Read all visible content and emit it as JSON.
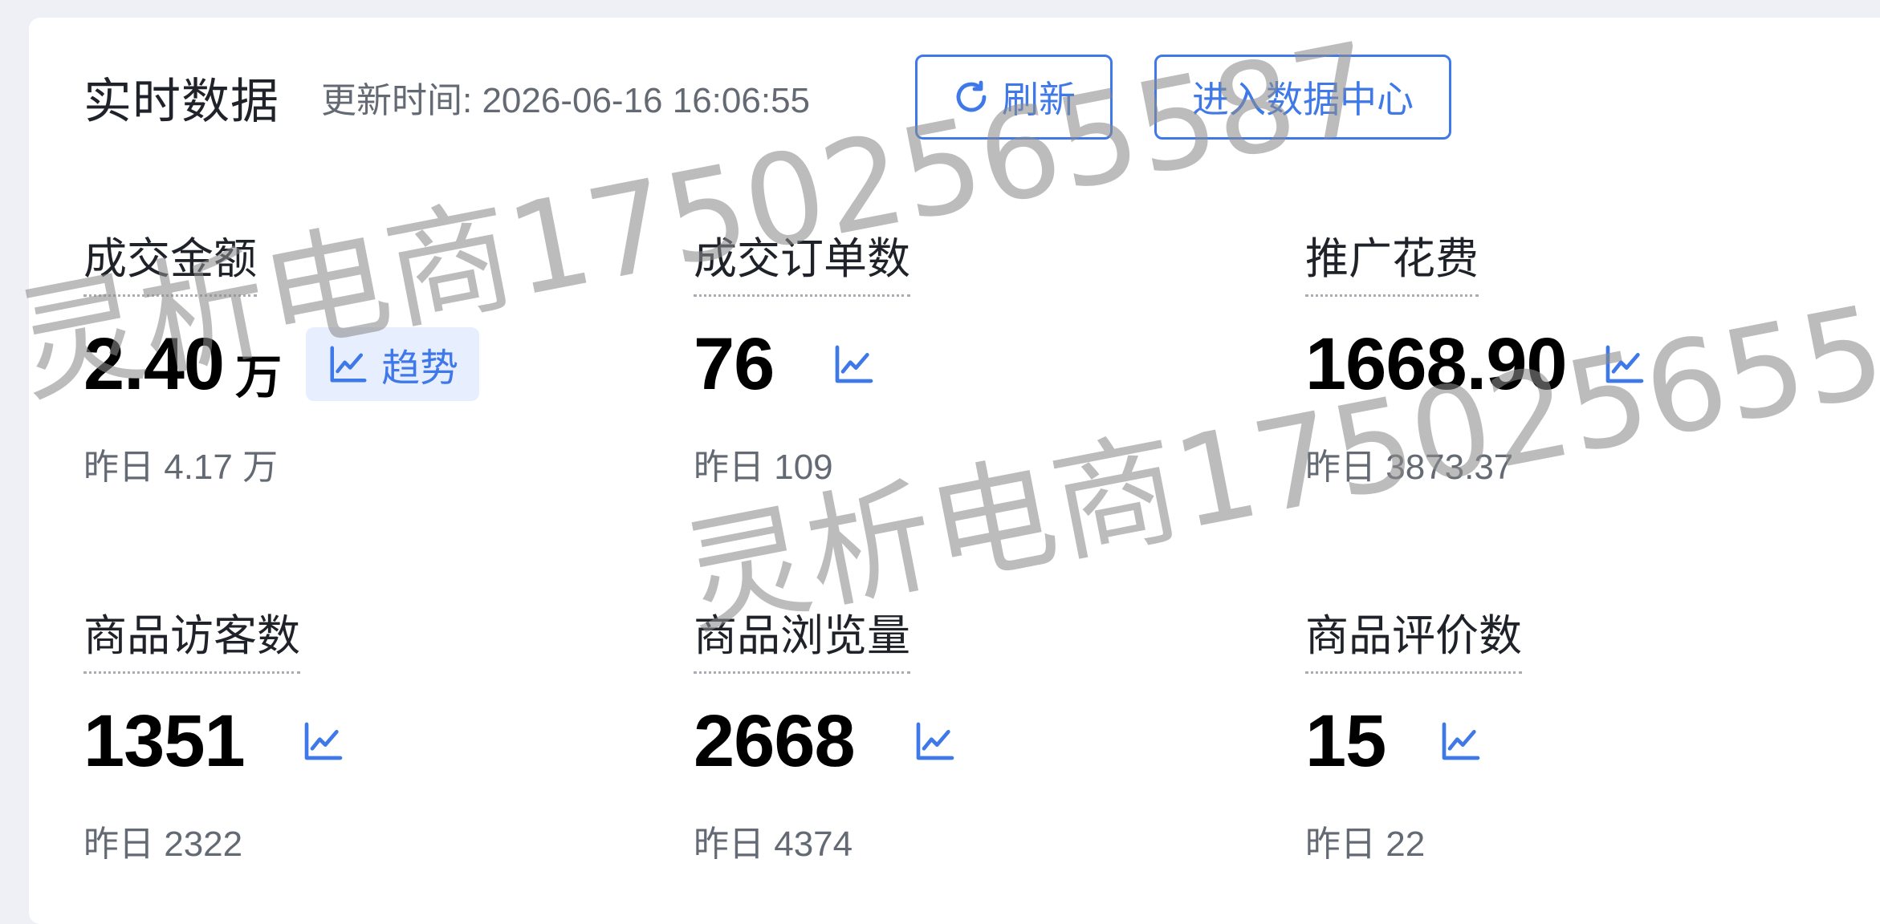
{
  "header": {
    "title": "实时数据",
    "update_time": "更新时间: 2026-06-16 16:06:55",
    "refresh_label": "刷新",
    "data_center_label": "进入数据中心"
  },
  "metrics": [
    {
      "label": "成交金额",
      "value": "2.40",
      "unit": "万",
      "trend_label": "趋势",
      "yesterday": "昨日 4.17 万"
    },
    {
      "label": "成交订单数",
      "value": "76",
      "yesterday": "昨日 109"
    },
    {
      "label": "推广花费",
      "value": "1668.90",
      "yesterday": "昨日 3873.37"
    },
    {
      "label": "商品访客数",
      "value": "1351",
      "yesterday": "昨日 2322"
    },
    {
      "label": "商品浏览量",
      "value": "2668",
      "yesterday": "昨日 4374"
    },
    {
      "label": "商品评价数",
      "value": "15",
      "yesterday": "昨日 22"
    }
  ],
  "watermark": "灵析电商17502565587",
  "colors": {
    "accent": "#3f78e8",
    "trend_pill_bg": "#e7efff",
    "page_bg": "#eff0f5"
  },
  "icons": {
    "refresh": "refresh-icon",
    "trend": "trend-line-icon"
  }
}
